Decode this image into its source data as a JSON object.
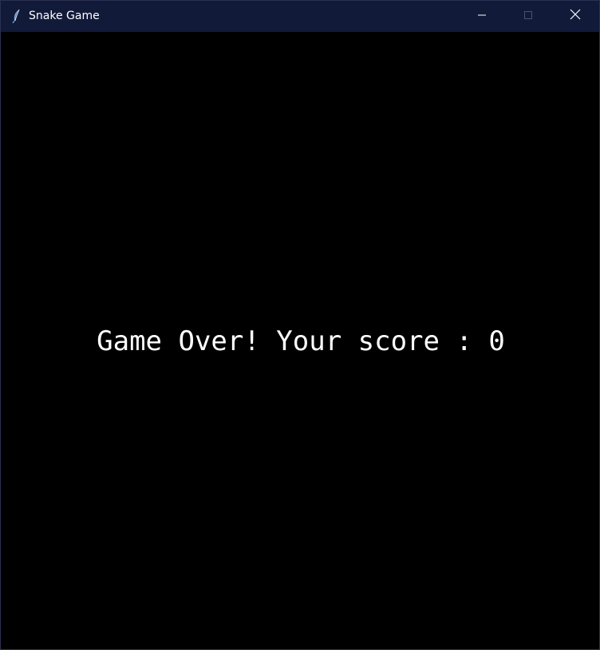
{
  "window": {
    "title": "Snake Game",
    "icon": "feather-icon",
    "controls": [
      "minimize-icon",
      "maximize-icon",
      "close-icon"
    ]
  },
  "game": {
    "message": "Game Over! Your score : 0",
    "background": "#000000",
    "text_color": "#ffffff"
  },
  "colors": {
    "titlebar": "#121a3a",
    "window_border": "#2b3050"
  }
}
